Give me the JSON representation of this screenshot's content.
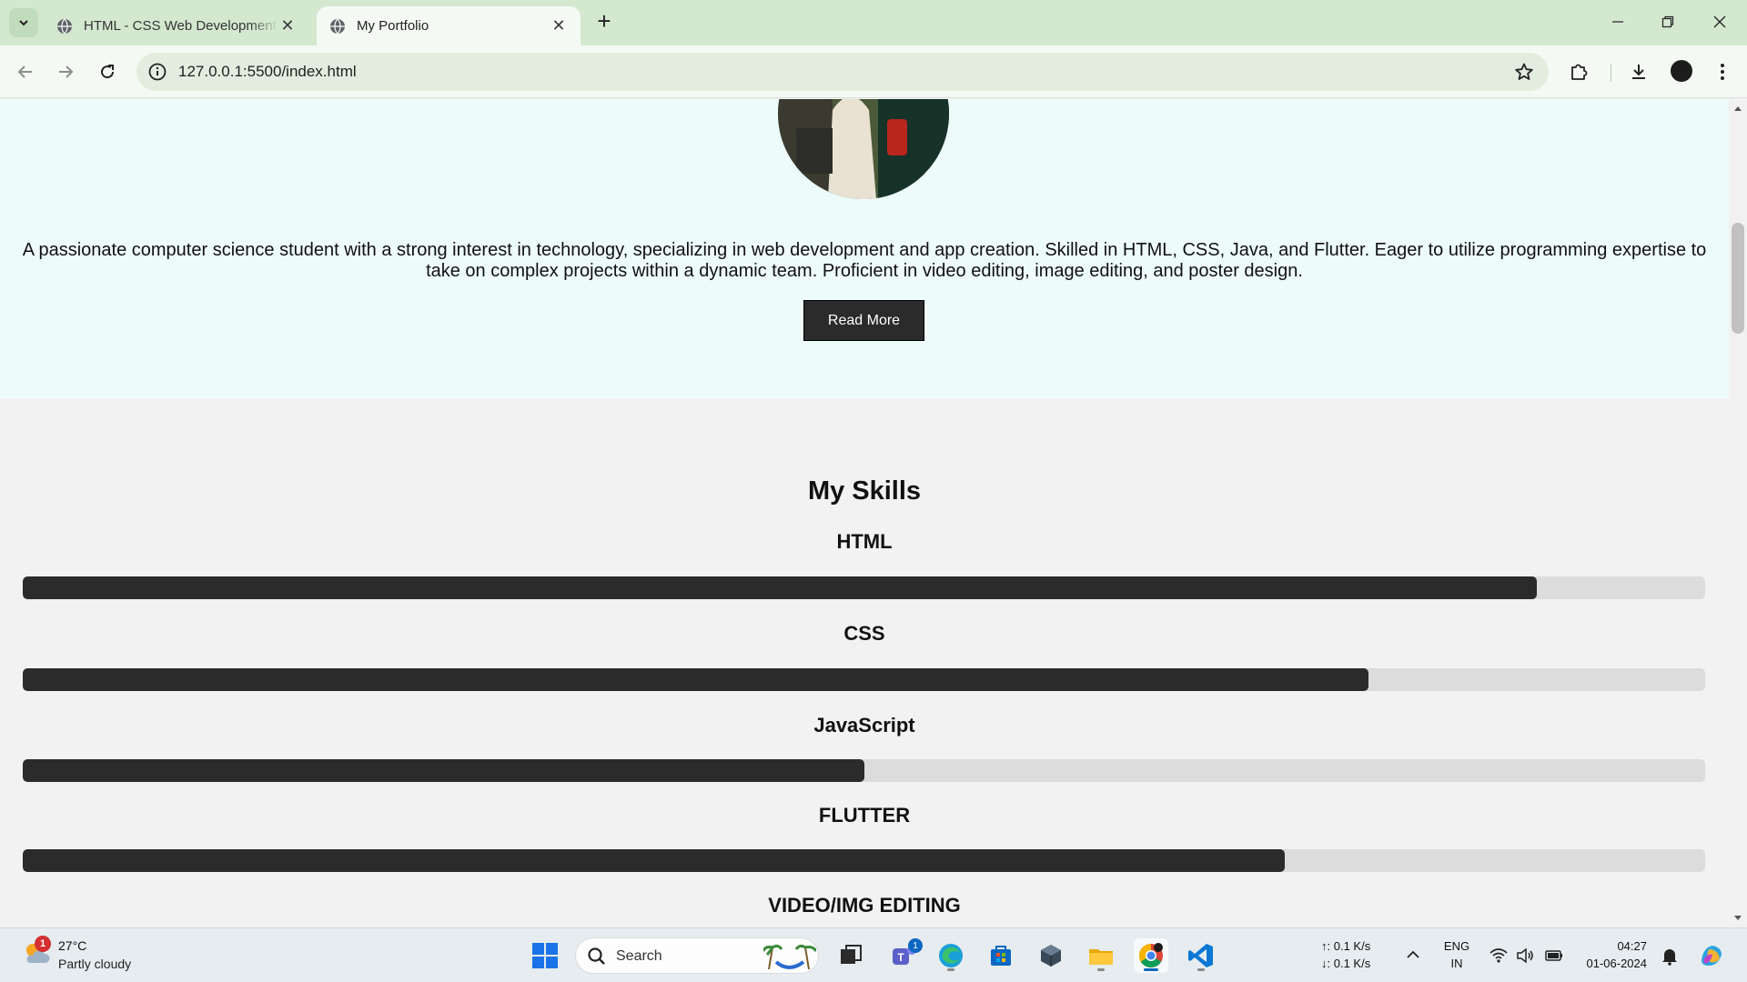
{
  "browser": {
    "tabs": [
      {
        "title": "HTML - CSS Web Development",
        "active": false
      },
      {
        "title": "My Portfolio",
        "active": true
      }
    ],
    "url": "127.0.0.1:5500/index.html"
  },
  "page": {
    "about_text": "A passionate computer science student with a strong interest in technology, specializing in web development and app creation. Skilled in HTML, CSS, Java, and Flutter. Eager to utilize programming expertise to take on complex projects within a dynamic team. Proficient in video editing, image editing, and poster design.",
    "read_more_label": "Read More",
    "skills_title": "My Skills",
    "skills": [
      {
        "name": "HTML",
        "level_percent": 90
      },
      {
        "name": "CSS",
        "level_percent": 80
      },
      {
        "name": "JavaScript",
        "level_percent": 50
      },
      {
        "name": "FLUTTER",
        "level_percent": 75
      },
      {
        "name": "VIDEO/IMG EDITING",
        "level_percent": null
      }
    ]
  },
  "taskbar": {
    "weather": {
      "temp": "27°C",
      "desc": "Partly cloudy",
      "badge": "1",
      "icon": "partly-cloudy-icon"
    },
    "search_label": "Search",
    "teams_badge": "1",
    "network_up": "↑: 0.1 K/s",
    "network_down": "↓: 0.1 K/s",
    "lang_line1": "ENG",
    "lang_line2": "IN",
    "time": "04:27",
    "date": "01-06-2024"
  },
  "colors": {
    "tabbar_bg": "#d3e8cf",
    "toolbar_bg": "#f4faf3",
    "hero_bg": "#eefbfb",
    "skill_fill": "#2b2b2b",
    "skill_track": "#dcdcdc",
    "button_bg": "#2b2b2b"
  }
}
